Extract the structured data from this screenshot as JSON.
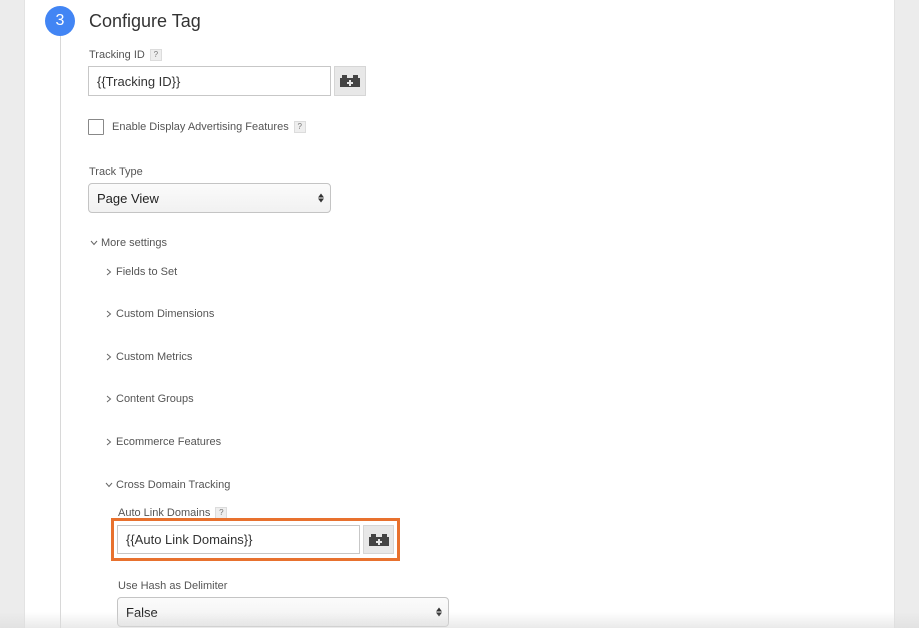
{
  "step": {
    "number": "3",
    "title": "Configure Tag"
  },
  "tracking_id": {
    "label": "Tracking ID",
    "help": "?",
    "value": "{{Tracking ID}}"
  },
  "display_ads": {
    "label": "Enable Display Advertising Features",
    "help": "?",
    "checked": false
  },
  "track_type": {
    "label": "Track Type",
    "value": "Page View"
  },
  "more_settings": {
    "label": "More settings",
    "expanded": true,
    "items": [
      {
        "label": "Fields to Set",
        "expanded": false
      },
      {
        "label": "Custom Dimensions",
        "expanded": false
      },
      {
        "label": "Custom Metrics",
        "expanded": false
      },
      {
        "label": "Content Groups",
        "expanded": false
      },
      {
        "label": "Ecommerce Features",
        "expanded": false
      },
      {
        "label": "Cross Domain Tracking",
        "expanded": true
      }
    ]
  },
  "cross_domain": {
    "auto_link": {
      "label": "Auto Link Domains",
      "help": "?",
      "value": "{{Auto Link Domains}}"
    },
    "use_hash": {
      "label": "Use Hash as Delimiter",
      "value": "False"
    }
  },
  "colors": {
    "accent": "#4285f4",
    "highlight": "#e8712e"
  },
  "icons": {
    "variable_button": "variable-brick-icon",
    "expanded": "chevron-down-icon",
    "collapsed": "chevron-right-icon"
  }
}
